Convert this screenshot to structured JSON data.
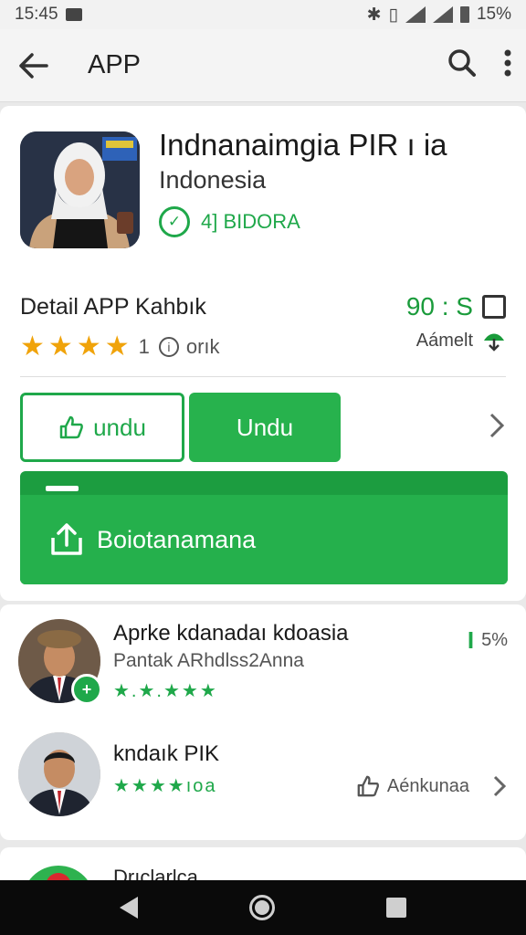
{
  "status_bar": {
    "time": "15:45",
    "battery": "15%"
  },
  "app_bar": {
    "title": "APP"
  },
  "app": {
    "name": "Indnanaimgia PIR ı ia",
    "subtitle": "Indonesia",
    "developer": "4] BIDORA"
  },
  "detail": {
    "title": "Detail APP Kahbık",
    "rating_count": "1",
    "rating_unit": "orık",
    "metric_value": "90 : S",
    "metric_label": "Aámelt"
  },
  "buttons": {
    "outline_label": "undu",
    "fill_label": "Undu",
    "banner_label": "Boiotanamana"
  },
  "list": [
    {
      "name": "Aprke kdanadaı kdoasia",
      "sub": "Pantak ARhdlss2Anna",
      "stars": "★.★.★★★",
      "right": "5%"
    },
    {
      "name": "kndaık PIK",
      "stars": "★★★★ıoa",
      "right": "Aénkunaa"
    }
  ],
  "peek": {
    "title": "Drıclarlca"
  },
  "colors": {
    "accent": "#25b04c",
    "star": "#f0a30a"
  }
}
